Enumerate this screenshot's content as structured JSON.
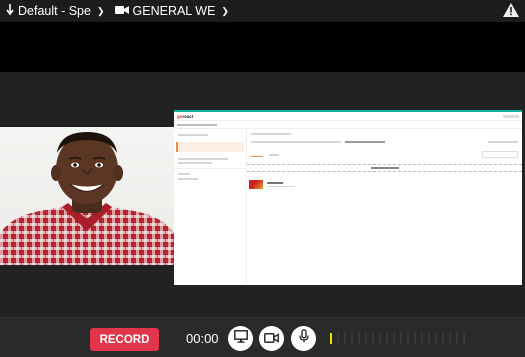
{
  "topbar": {
    "audio_device": "Default - Spe",
    "camera_device": "GENERAL WE"
  },
  "screen_share": {
    "app_logo_prefix": "go",
    "app_logo_rest": "react"
  },
  "controls": {
    "record_label": "RECORD",
    "timer": "00:00",
    "mic_level_fraction": 0.05
  },
  "colors": {
    "record": "#e0354b",
    "accent_share_border": "#12b5a5",
    "meter_on": "#f3e400"
  }
}
